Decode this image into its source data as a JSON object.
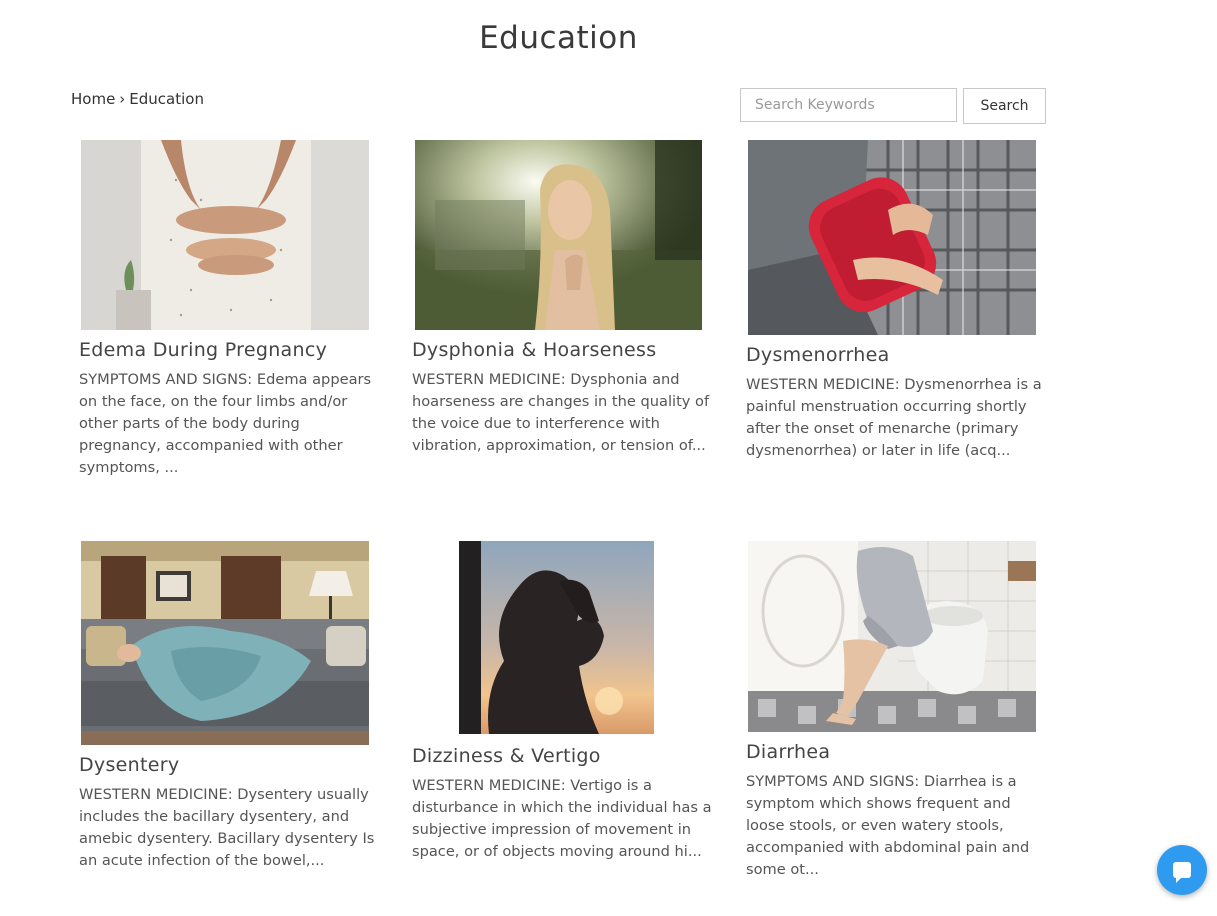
{
  "page": {
    "title": "Education"
  },
  "breadcrumb": {
    "home": "Home",
    "separator": "›",
    "current": "Education"
  },
  "search": {
    "placeholder": "Search Keywords",
    "value": "",
    "button_label": "Search"
  },
  "articles": [
    {
      "title": "Edema During Pregnancy",
      "excerpt": "SYMPTOMS AND SIGNS: Edema appears on the face, on the four limbs and/or other parts of the body during pregnancy, accompanied with other symptoms, ...",
      "image": "pregnant belly with hands"
    },
    {
      "title": "Dysphonia & Hoarseness",
      "excerpt": "WESTERN MEDICINE: Dysphonia and hoarseness are changes in the quality of the voice due to interference with vibration, approximation, or tension of...",
      "image": "woman touching throat in sunlight"
    },
    {
      "title": "Dysmenorrhea",
      "excerpt": "WESTERN MEDICINE: Dysmenorrhea is a painful menstruation occurring shortly after the onset of menarche (primary dysmenorrhea) or later in life (acq...",
      "image": "hot water bottle on abdomen"
    },
    {
      "title": "Dysentery",
      "excerpt": "WESTERN MEDICINE: Dysentery usually includes the bacillary dysentery, and amebic dysentery. Bacillary dysentery Is an acute infection of the bowel,...",
      "image": "person lying on sofa under blanket"
    },
    {
      "title": "Dizziness & Vertigo",
      "excerpt": "WESTERN MEDICINE: Vertigo is a disturbance in which the individual has a subjective impression of movement in space, or of objects moving around hi...",
      "image": "silhouette holding head at sunset"
    },
    {
      "title": "Diarrhea",
      "excerpt": "SYMPTOMS AND SIGNS: Diarrhea is a symptom which shows frequent and loose stools, or even watery stools, accompanied with abdominal pain and some ot...",
      "image": "person sitting on toilet"
    }
  ],
  "chat": {
    "icon": "chat-bubble-icon"
  },
  "colors": {
    "chat_accent": "#2e9bf0",
    "text": "#444444",
    "border": "#c8c8c8"
  }
}
